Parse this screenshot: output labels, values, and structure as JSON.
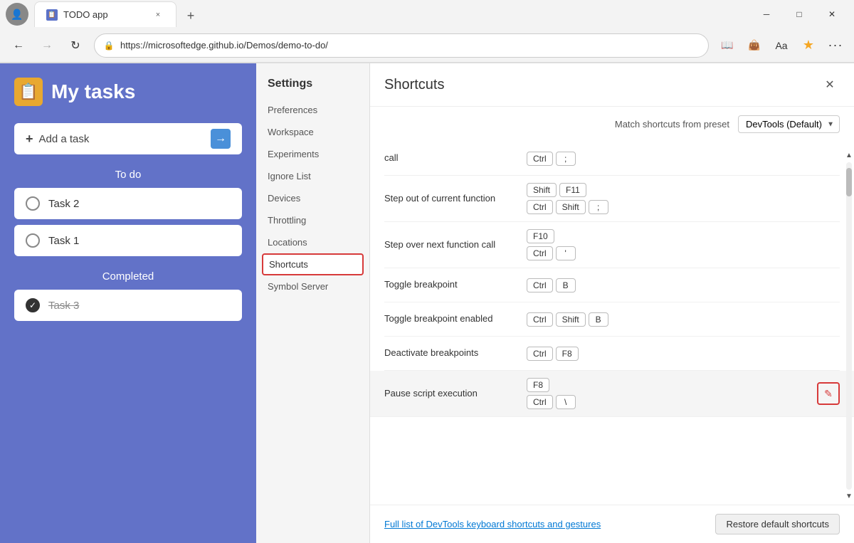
{
  "browser": {
    "tab": {
      "favicon": "📋",
      "title": "TODO app",
      "close": "×"
    },
    "new_tab": "+",
    "nav": {
      "back": "←",
      "forward": "→",
      "refresh": "↻",
      "url": "https://microsoftedge.github.io/Demos/demo-to-do/",
      "lock_icon": "🔒"
    },
    "window_controls": {
      "minimize": "─",
      "maximize": "□",
      "close": "✕"
    }
  },
  "todo": {
    "icon": "📋",
    "title": "My tasks",
    "add_placeholder": "+ Add a task",
    "sections": {
      "todo": "To do",
      "completed": "Completed"
    },
    "tasks": [
      {
        "id": 1,
        "label": "Task 2",
        "done": false
      },
      {
        "id": 2,
        "label": "Task 1",
        "done": false
      }
    ],
    "completed_tasks": [
      {
        "id": 3,
        "label": "Task 3",
        "done": true
      }
    ]
  },
  "settings": {
    "title": "Settings",
    "items": [
      {
        "id": "preferences",
        "label": "Preferences",
        "active": false
      },
      {
        "id": "workspace",
        "label": "Workspace",
        "active": false
      },
      {
        "id": "experiments",
        "label": "Experiments",
        "active": false
      },
      {
        "id": "ignore-list",
        "label": "Ignore List",
        "active": false
      },
      {
        "id": "devices",
        "label": "Devices",
        "active": false
      },
      {
        "id": "throttling",
        "label": "Throttling",
        "active": false
      },
      {
        "id": "locations",
        "label": "Locations",
        "active": false
      },
      {
        "id": "shortcuts",
        "label": "Shortcuts",
        "active": true
      },
      {
        "id": "symbol-server",
        "label": "Symbol Server",
        "active": false
      }
    ]
  },
  "shortcuts": {
    "title": "Shortcuts",
    "preset_label": "Match shortcuts from preset",
    "preset_value": "DevTools (Default)",
    "close_btn": "✕",
    "items": [
      {
        "id": "call",
        "name": "call",
        "keys": [
          [
            "Ctrl",
            ";"
          ]
        ]
      },
      {
        "id": "step-out",
        "name": "Step out of current function",
        "keys": [
          [
            "Shift",
            "F11"
          ],
          [
            "Ctrl",
            "Shift",
            ";"
          ]
        ]
      },
      {
        "id": "step-over",
        "name": "Step over next function call",
        "keys": [
          [
            "F10"
          ],
          [
            "Ctrl",
            "'"
          ]
        ]
      },
      {
        "id": "toggle-breakpoint",
        "name": "Toggle breakpoint",
        "keys": [
          [
            "Ctrl",
            "B"
          ]
        ]
      },
      {
        "id": "toggle-breakpoint-enabled",
        "name": "Toggle breakpoint enabled",
        "keys": [
          [
            "Ctrl",
            "Shift",
            "B"
          ]
        ]
      },
      {
        "id": "deactivate-breakpoints",
        "name": "Deactivate breakpoints",
        "keys": [
          [
            "Ctrl",
            "F8"
          ]
        ]
      },
      {
        "id": "pause-script",
        "name": "Pause script execution",
        "keys": [
          [
            "F8"
          ],
          [
            "Ctrl",
            "\\"
          ]
        ]
      }
    ],
    "footer": {
      "link": "Full list of DevTools keyboard shortcuts and gestures",
      "restore_btn": "Restore default shortcuts"
    }
  }
}
